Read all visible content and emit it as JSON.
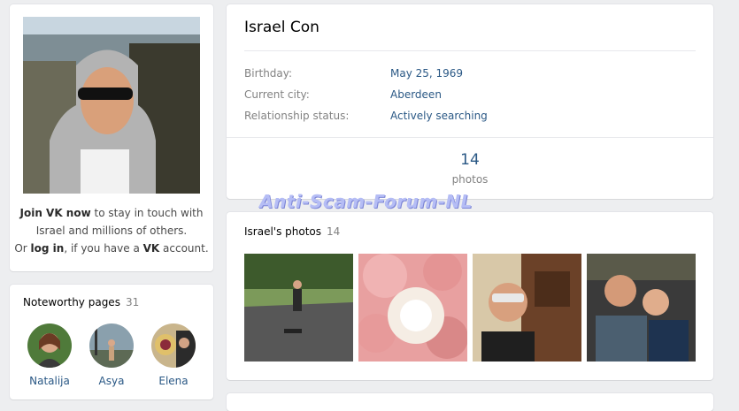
{
  "profile": {
    "name": "Israel Con",
    "join": {
      "join_link": "Join VK now",
      "text1": " to stay in touch with",
      "text2": "Israel and millions of others.",
      "or": "Or ",
      "login_link": "log in",
      "text3": ", if you have a ",
      "vk": "VK",
      "text4": " account."
    },
    "fields": [
      {
        "label": "Birthday:",
        "value": "May 25, 1969"
      },
      {
        "label": "Current city:",
        "value": "Aberdeen"
      },
      {
        "label": "Relationship status:",
        "value": "Actively searching"
      }
    ],
    "photo_count": "14",
    "photo_count_label": "photos"
  },
  "noteworthy": {
    "title": "Noteworthy pages",
    "count": "31",
    "items": [
      {
        "name": "Natalija"
      },
      {
        "name": "Asya"
      },
      {
        "name": "Elena"
      }
    ]
  },
  "photos": {
    "title": "Israel's photos",
    "count": "14"
  },
  "watermark": "Anti-Scam-Forum-NL",
  "colors": {
    "link": "#2a5885",
    "background": "#edeef0",
    "card": "#ffffff",
    "muted": "#828282"
  }
}
